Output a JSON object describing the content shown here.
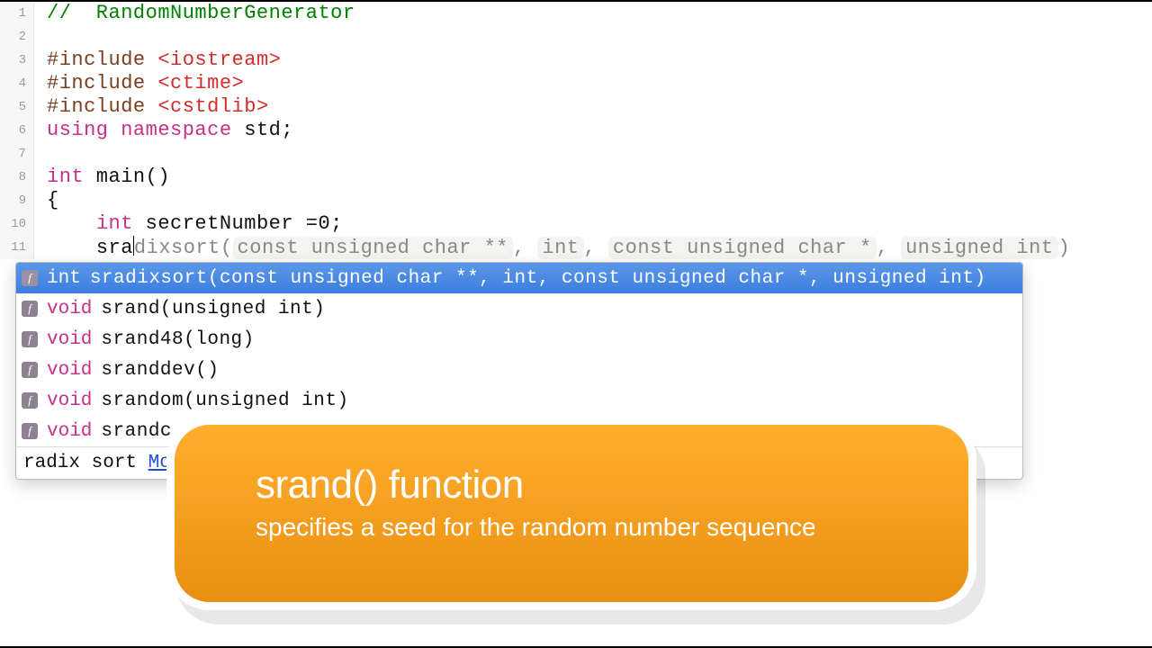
{
  "lines": [
    {
      "n": 1,
      "parts": [
        {
          "cls": "comment",
          "t": "//  RandomNumberGenerator"
        }
      ]
    },
    {
      "n": 2,
      "parts": []
    },
    {
      "n": 3,
      "parts": [
        {
          "cls": "preproc",
          "t": "#include "
        },
        {
          "cls": "angle",
          "t": "<iostream>"
        }
      ]
    },
    {
      "n": 4,
      "parts": [
        {
          "cls": "preproc",
          "t": "#include "
        },
        {
          "cls": "angle",
          "t": "<ctime>"
        }
      ]
    },
    {
      "n": 5,
      "parts": [
        {
          "cls": "preproc",
          "t": "#include "
        },
        {
          "cls": "angle",
          "t": "<cstdlib>"
        }
      ]
    },
    {
      "n": 6,
      "parts": [
        {
          "cls": "keyword",
          "t": "using namespace"
        },
        {
          "cls": "plain",
          "t": " std;"
        }
      ]
    },
    {
      "n": 7,
      "parts": []
    },
    {
      "n": 8,
      "parts": [
        {
          "cls": "keyword",
          "t": "int"
        },
        {
          "cls": "plain",
          "t": " main()"
        }
      ]
    },
    {
      "n": 9,
      "parts": [
        {
          "cls": "plain",
          "t": "{"
        }
      ]
    },
    {
      "n": 10,
      "parts": [
        {
          "cls": "plain",
          "t": "    "
        },
        {
          "cls": "keyword",
          "t": "int"
        },
        {
          "cls": "plain",
          "t": " secretNumber ="
        },
        {
          "cls": "plain",
          "t": "0"
        },
        {
          "cls": "plain",
          "t": ";"
        }
      ]
    }
  ],
  "line11": {
    "n": 11,
    "prefix_indent": "    ",
    "typed": "sra",
    "ghost_pre": "dixsort(",
    "hints": [
      "const unsigned char **",
      ", ",
      "int",
      ", ",
      "const unsigned char *",
      ", ",
      "unsigned int"
    ],
    "ghost_post": ")"
  },
  "popup": {
    "rows": [
      {
        "ret": "int",
        "sig": "sradixsort(const unsigned char **, int, const unsigned char *, unsigned int)",
        "selected": true
      },
      {
        "ret": "void",
        "sig": "srand(unsigned int)",
        "selected": false
      },
      {
        "ret": "void",
        "sig": "srand48(long)",
        "selected": false
      },
      {
        "ret": "void",
        "sig": "sranddev()",
        "selected": false
      },
      {
        "ret": "void",
        "sig": "srandom(unsigned int)",
        "selected": false
      },
      {
        "ret": "void",
        "sig": "srandc",
        "selected": false
      }
    ],
    "footer_text": "radix sort ",
    "footer_link": "Mo"
  },
  "callout": {
    "title": "srand() function",
    "sub": "specifies a seed for the random number sequence"
  }
}
